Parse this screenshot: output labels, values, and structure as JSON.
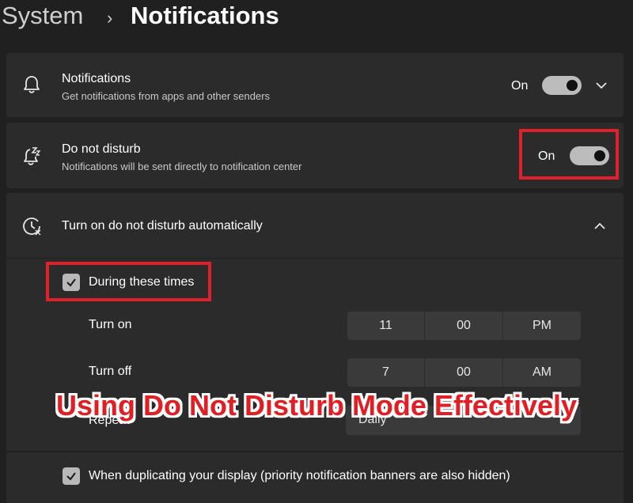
{
  "breadcrumb": {
    "parent": "System",
    "separator": "›",
    "current": "Notifications"
  },
  "notifications": {
    "title": "Notifications",
    "subtitle": "Get notifications from apps and other senders",
    "state": "On",
    "icon": "bell-icon"
  },
  "dnd": {
    "title": "Do not disturb",
    "subtitle": "Notifications will be sent directly to notification center",
    "state": "On",
    "icon": "bell-snooze-icon"
  },
  "auto": {
    "title": "Turn on do not disturb automatically",
    "icon": "clock-icon",
    "during_times": "During these times",
    "turn_on": {
      "label": "Turn on",
      "hour": "11",
      "minute": "00",
      "ampm": "PM"
    },
    "turn_off": {
      "label": "Turn off",
      "hour": "7",
      "minute": "00",
      "ampm": "AM"
    },
    "repeat": {
      "label": "Repeat",
      "value": "Daily"
    },
    "duplicating": "When duplicating your display (priority notification banners are also hidden)"
  },
  "overlay_title": "Using Do Not Disturb Mode Effectively",
  "colors": {
    "highlight": "#e0202a",
    "background": "#202020",
    "card": "#2b2b2b"
  }
}
